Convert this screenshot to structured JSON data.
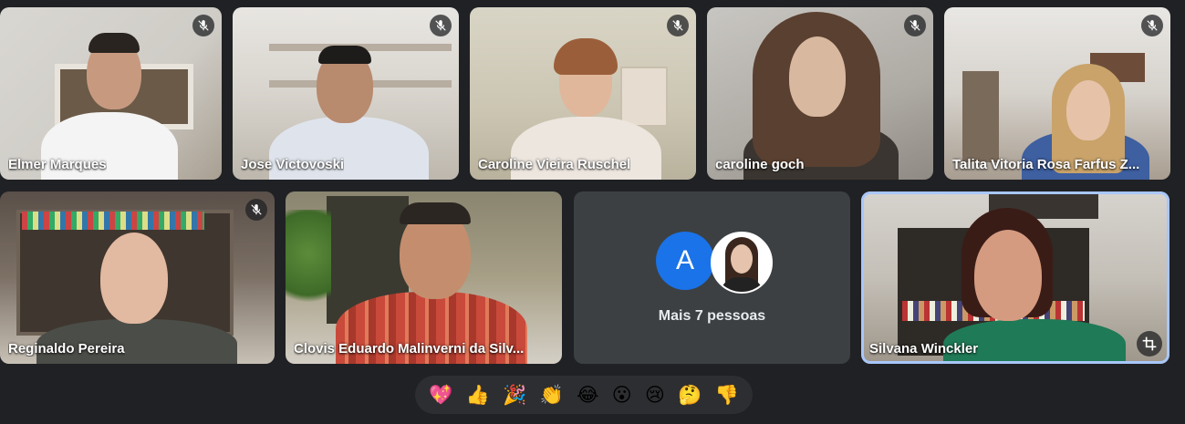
{
  "participants": [
    {
      "name": "Elmer Marques",
      "muted": true
    },
    {
      "name": "Jose Victovoski",
      "muted": true
    },
    {
      "name": "Caroline Vieira Ruschel",
      "muted": true
    },
    {
      "name": "caroline goch",
      "muted": true
    },
    {
      "name": "Talita Vitoria Rosa Farfus Z...",
      "muted": true
    },
    {
      "name": "Reginaldo Pereira",
      "muted": true
    },
    {
      "name": "Clovis Eduardo Malinverni da Silv...",
      "muted": false
    },
    {
      "name": "Silvana Winckler",
      "muted": false,
      "active_speaker": true
    }
  ],
  "more_tile": {
    "avatar_letter": "A",
    "label": "Mais 7 pessoas",
    "avatar_color": "#1a73e8"
  },
  "reactions": [
    {
      "icon": "sparkling-heart-icon",
      "glyph": "💖"
    },
    {
      "icon": "thumbs-up-icon",
      "glyph": "👍"
    },
    {
      "icon": "party-popper-icon",
      "glyph": "🎉"
    },
    {
      "icon": "clapping-hands-icon",
      "glyph": "👏"
    },
    {
      "icon": "tears-of-joy-icon",
      "glyph": "😂"
    },
    {
      "icon": "surprised-face-icon",
      "glyph": "😮"
    },
    {
      "icon": "crying-face-icon",
      "glyph": "😢"
    },
    {
      "icon": "thinking-face-icon",
      "glyph": "🤔"
    },
    {
      "icon": "thumbs-down-icon",
      "glyph": "👎"
    }
  ],
  "colors": {
    "background": "#202124",
    "tile_background": "#3c4043",
    "active_speaker_border": "#a8c7fa",
    "reaction_bar": "#2d2e31"
  }
}
